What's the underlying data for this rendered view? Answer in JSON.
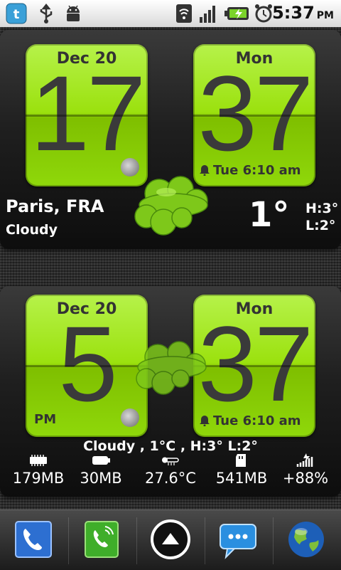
{
  "status_bar": {
    "time": "5:37",
    "ampm": "PM",
    "icons": [
      "twitter-icon",
      "usb-icon",
      "android-debug-icon",
      "wifi-icon",
      "signal-icon",
      "battery-charging-icon",
      "alarm-clock-icon"
    ]
  },
  "widget1": {
    "hour_card": {
      "date": "Dec  20",
      "hour": "17"
    },
    "minute_card": {
      "day": "Mon",
      "minute": "37",
      "alarm": "Tue 6:10 am"
    },
    "location": "Paris, FRA",
    "condition": "Cloudy",
    "temperature": "1°",
    "high": "H:3°",
    "low": "L:2°"
  },
  "widget2": {
    "hour_card": {
      "date": "Dec  20",
      "hour": "5",
      "ampm": "PM"
    },
    "minute_card": {
      "day": "Mon",
      "minute": "37",
      "alarm": "Tue 6:10 am"
    },
    "summary": "Cloudy , 1°C , H:3° L:2°",
    "stats": [
      {
        "icon": "memory-icon",
        "value": "179MB"
      },
      {
        "icon": "battery-icon",
        "value": "30MB"
      },
      {
        "icon": "thermometer-icon",
        "value": "27.6°C"
      },
      {
        "icon": "sd-card-icon",
        "value": "541MB"
      },
      {
        "icon": "battery-level-icon",
        "value": "+88%"
      }
    ]
  },
  "dock": {
    "items": [
      "phone-icon",
      "dialer-icon",
      "app-drawer-icon",
      "messaging-icon",
      "browser-globe-icon"
    ]
  },
  "colors": {
    "accent_green": "#9be10e",
    "digit": "#3a3a3a"
  }
}
